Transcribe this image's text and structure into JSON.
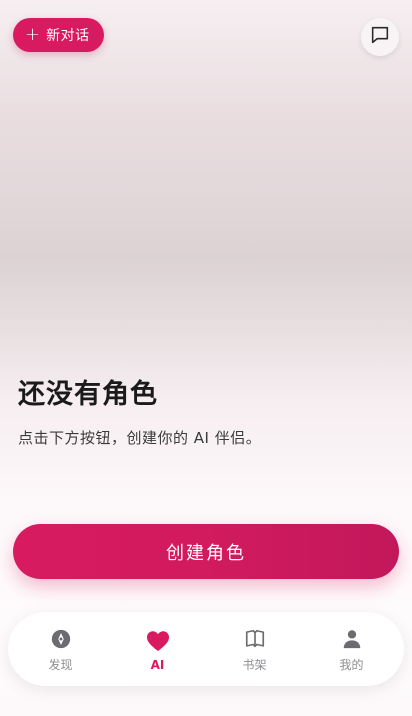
{
  "top_bar": {
    "new_chat_label": "新对话",
    "new_chat_icon": "plus-icon",
    "history_icon": "message-square-icon"
  },
  "empty_state": {
    "title": "还没有角色",
    "subtitle": "点击下方按钮，创建你的 AI 伴侣。"
  },
  "create_button": {
    "label": "创建角色"
  },
  "bottom_nav": {
    "items": [
      {
        "label": "发现",
        "icon": "compass-icon",
        "active": false
      },
      {
        "label": "AI",
        "icon": "heart-icon",
        "active": true
      },
      {
        "label": "书架",
        "icon": "book-open-icon",
        "active": false
      },
      {
        "label": "我的",
        "icon": "user-icon",
        "active": false
      }
    ]
  },
  "colors": {
    "accent": "#d81b60",
    "inactive": "#8e8e93"
  }
}
